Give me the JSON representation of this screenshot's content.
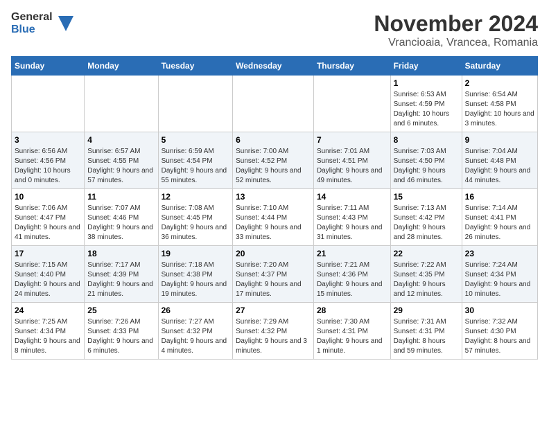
{
  "logo": {
    "general": "General",
    "blue": "Blue"
  },
  "title": "November 2024",
  "subtitle": "Vrancioaia, Vrancea, Romania",
  "days_of_week": [
    "Sunday",
    "Monday",
    "Tuesday",
    "Wednesday",
    "Thursday",
    "Friday",
    "Saturday"
  ],
  "weeks": [
    [
      {
        "day": "",
        "info": ""
      },
      {
        "day": "",
        "info": ""
      },
      {
        "day": "",
        "info": ""
      },
      {
        "day": "",
        "info": ""
      },
      {
        "day": "",
        "info": ""
      },
      {
        "day": "1",
        "info": "Sunrise: 6:53 AM\nSunset: 4:59 PM\nDaylight: 10 hours and 6 minutes."
      },
      {
        "day": "2",
        "info": "Sunrise: 6:54 AM\nSunset: 4:58 PM\nDaylight: 10 hours and 3 minutes."
      }
    ],
    [
      {
        "day": "3",
        "info": "Sunrise: 6:56 AM\nSunset: 4:56 PM\nDaylight: 10 hours and 0 minutes."
      },
      {
        "day": "4",
        "info": "Sunrise: 6:57 AM\nSunset: 4:55 PM\nDaylight: 9 hours and 57 minutes."
      },
      {
        "day": "5",
        "info": "Sunrise: 6:59 AM\nSunset: 4:54 PM\nDaylight: 9 hours and 55 minutes."
      },
      {
        "day": "6",
        "info": "Sunrise: 7:00 AM\nSunset: 4:52 PM\nDaylight: 9 hours and 52 minutes."
      },
      {
        "day": "7",
        "info": "Sunrise: 7:01 AM\nSunset: 4:51 PM\nDaylight: 9 hours and 49 minutes."
      },
      {
        "day": "8",
        "info": "Sunrise: 7:03 AM\nSunset: 4:50 PM\nDaylight: 9 hours and 46 minutes."
      },
      {
        "day": "9",
        "info": "Sunrise: 7:04 AM\nSunset: 4:48 PM\nDaylight: 9 hours and 44 minutes."
      }
    ],
    [
      {
        "day": "10",
        "info": "Sunrise: 7:06 AM\nSunset: 4:47 PM\nDaylight: 9 hours and 41 minutes."
      },
      {
        "day": "11",
        "info": "Sunrise: 7:07 AM\nSunset: 4:46 PM\nDaylight: 9 hours and 38 minutes."
      },
      {
        "day": "12",
        "info": "Sunrise: 7:08 AM\nSunset: 4:45 PM\nDaylight: 9 hours and 36 minutes."
      },
      {
        "day": "13",
        "info": "Sunrise: 7:10 AM\nSunset: 4:44 PM\nDaylight: 9 hours and 33 minutes."
      },
      {
        "day": "14",
        "info": "Sunrise: 7:11 AM\nSunset: 4:43 PM\nDaylight: 9 hours and 31 minutes."
      },
      {
        "day": "15",
        "info": "Sunrise: 7:13 AM\nSunset: 4:42 PM\nDaylight: 9 hours and 28 minutes."
      },
      {
        "day": "16",
        "info": "Sunrise: 7:14 AM\nSunset: 4:41 PM\nDaylight: 9 hours and 26 minutes."
      }
    ],
    [
      {
        "day": "17",
        "info": "Sunrise: 7:15 AM\nSunset: 4:40 PM\nDaylight: 9 hours and 24 minutes."
      },
      {
        "day": "18",
        "info": "Sunrise: 7:17 AM\nSunset: 4:39 PM\nDaylight: 9 hours and 21 minutes."
      },
      {
        "day": "19",
        "info": "Sunrise: 7:18 AM\nSunset: 4:38 PM\nDaylight: 9 hours and 19 minutes."
      },
      {
        "day": "20",
        "info": "Sunrise: 7:20 AM\nSunset: 4:37 PM\nDaylight: 9 hours and 17 minutes."
      },
      {
        "day": "21",
        "info": "Sunrise: 7:21 AM\nSunset: 4:36 PM\nDaylight: 9 hours and 15 minutes."
      },
      {
        "day": "22",
        "info": "Sunrise: 7:22 AM\nSunset: 4:35 PM\nDaylight: 9 hours and 12 minutes."
      },
      {
        "day": "23",
        "info": "Sunrise: 7:24 AM\nSunset: 4:34 PM\nDaylight: 9 hours and 10 minutes."
      }
    ],
    [
      {
        "day": "24",
        "info": "Sunrise: 7:25 AM\nSunset: 4:34 PM\nDaylight: 9 hours and 8 minutes."
      },
      {
        "day": "25",
        "info": "Sunrise: 7:26 AM\nSunset: 4:33 PM\nDaylight: 9 hours and 6 minutes."
      },
      {
        "day": "26",
        "info": "Sunrise: 7:27 AM\nSunset: 4:32 PM\nDaylight: 9 hours and 4 minutes."
      },
      {
        "day": "27",
        "info": "Sunrise: 7:29 AM\nSunset: 4:32 PM\nDaylight: 9 hours and 3 minutes."
      },
      {
        "day": "28",
        "info": "Sunrise: 7:30 AM\nSunset: 4:31 PM\nDaylight: 9 hours and 1 minute."
      },
      {
        "day": "29",
        "info": "Sunrise: 7:31 AM\nSunset: 4:31 PM\nDaylight: 8 hours and 59 minutes."
      },
      {
        "day": "30",
        "info": "Sunrise: 7:32 AM\nSunset: 4:30 PM\nDaylight: 8 hours and 57 minutes."
      }
    ]
  ]
}
